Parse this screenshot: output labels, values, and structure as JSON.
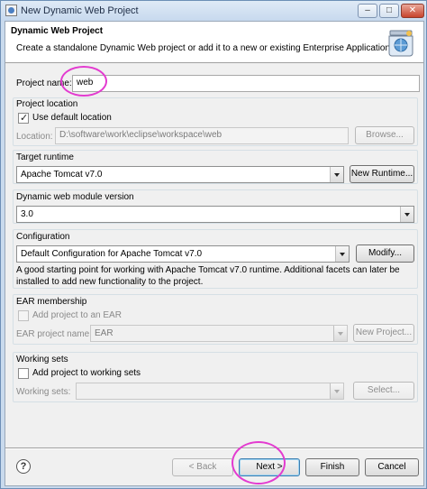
{
  "window": {
    "title": "New Dynamic Web Project",
    "controls": {
      "minimize": "–",
      "maximize": "□",
      "close": "✕"
    }
  },
  "header": {
    "title": "Dynamic Web Project",
    "description": "Create a standalone Dynamic Web project or add it to a new or existing Enterprise Application.",
    "graphic_icon": "web-project-jar-icon"
  },
  "project_name": {
    "label": "Project name:",
    "value": "web"
  },
  "project_location": {
    "group_label": "Project location",
    "use_default_label": "Use default location",
    "use_default_checked": true,
    "location_label": "Location:",
    "location_value": "D:\\software\\work\\eclipse\\workspace\\web",
    "browse_label": "Browse..."
  },
  "target_runtime": {
    "group_label": "Target runtime",
    "selected": "Apache Tomcat v7.0",
    "new_runtime_label": "New Runtime..."
  },
  "module_version": {
    "group_label": "Dynamic web module version",
    "selected": "3.0"
  },
  "configuration": {
    "group_label": "Configuration",
    "selected": "Default Configuration for Apache Tomcat v7.0",
    "modify_label": "Modify...",
    "description_line1": "A good starting point for working with Apache Tomcat v7.0 runtime. Additional facets can later be",
    "description_line2": "installed to add new functionality to the project."
  },
  "ear_membership": {
    "group_label": "EAR membership",
    "add_to_ear_label": "Add project to an EAR",
    "add_to_ear_checked": false,
    "ear_name_label": "EAR project name:",
    "ear_name_value": "EAR",
    "new_project_label": "New Project..."
  },
  "working_sets": {
    "group_label": "Working sets",
    "add_label": "Add project to working sets",
    "add_checked": false,
    "sets_label": "Working sets:",
    "sets_value": "",
    "select_label": "Select..."
  },
  "footer": {
    "help": "?",
    "back_label": "< Back",
    "next_label": "Next >",
    "finish_label": "Finish",
    "cancel_label": "Cancel"
  },
  "colors": {
    "annotation": "#e33bd0",
    "default_button_border": "#3c7fb1"
  }
}
